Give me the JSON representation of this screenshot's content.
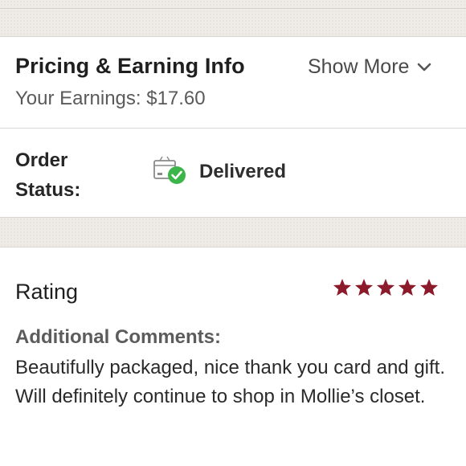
{
  "pricing": {
    "title": "Pricing & Earning Info",
    "show_more_label": "Show More",
    "earnings_text": "Your Earnings: $17.60"
  },
  "order": {
    "status_label": "Order Status:",
    "status_value": "Delivered",
    "status_icon": "package-delivered-icon",
    "status_color": "#3cb54a"
  },
  "rating": {
    "title": "Rating",
    "stars": 5,
    "max_stars": 5,
    "star_color": "#8b1a2b",
    "comments_label": "Additional Comments:",
    "comments_text": "Beautifully packaged, nice thank you card and gift. Will definitely continue to shop in Mollie’s closet."
  }
}
